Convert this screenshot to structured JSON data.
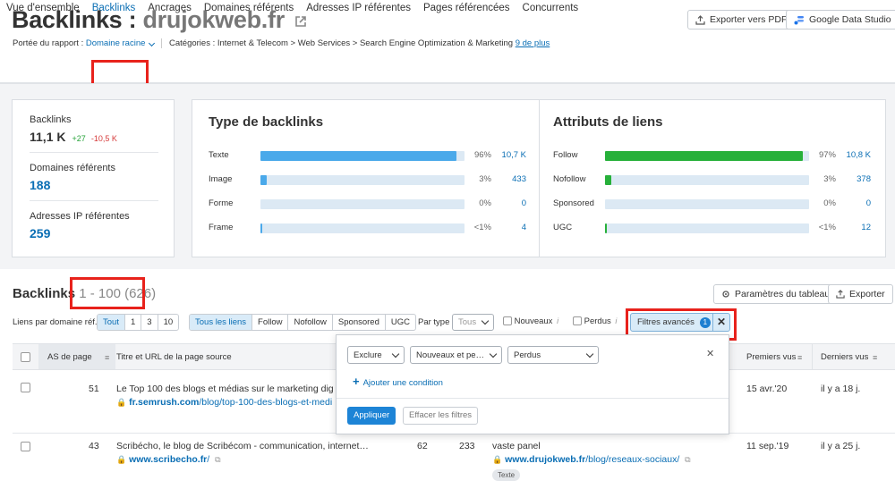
{
  "header": {
    "title_prefix": "Backlinks : ",
    "title_domain": "drujokweb.fr",
    "export_pdf": "Exporter vers PDF",
    "gds": "Google Data Studio"
  },
  "meta": {
    "scope_label": "Portée du rapport :",
    "scope_value": "Domaine racine",
    "categories": "Catégories : Internet & Telecom > Web Services > Search Engine Optimization & Marketing",
    "more": "9 de plus"
  },
  "tabs": [
    "Vue d'ensemble",
    "Backlinks",
    "Ancrages",
    "Domaines référents",
    "Adresses IP référentes",
    "Pages référencées",
    "Concurrents"
  ],
  "kpis": {
    "backlinks_label": "Backlinks",
    "backlinks_value": "11,1 K",
    "backlinks_up": "+27",
    "backlinks_down": "-10,5 K",
    "domains_label": "Domaines référents",
    "domains_value": "188",
    "ips_label": "Adresses IP référentes",
    "ips_value": "259"
  },
  "types": {
    "title": "Type de backlinks",
    "rows": [
      {
        "label": "Texte",
        "pct": "96%",
        "count": "10,7 K",
        "fill": 0.96
      },
      {
        "label": "Image",
        "pct": "3%",
        "count": "433",
        "fill": 0.03
      },
      {
        "label": "Forme",
        "pct": "0%",
        "count": "0",
        "fill": 0
      },
      {
        "label": "Frame",
        "pct": "<1%",
        "count": "4",
        "fill": 0.005
      }
    ]
  },
  "attributes": {
    "title": "Attributs de liens",
    "rows": [
      {
        "label": "Follow",
        "pct": "97%",
        "count": "10,8 K",
        "fill": 0.97
      },
      {
        "label": "Nofollow",
        "pct": "3%",
        "count": "378",
        "fill": 0.03
      },
      {
        "label": "Sponsored",
        "pct": "0%",
        "count": "0",
        "fill": 0
      },
      {
        "label": "UGC",
        "pct": "<1%",
        "count": "12",
        "fill": 0.005
      }
    ]
  },
  "colors": {
    "blue_bar": "#4aa9ea",
    "green_bar": "#27b03a",
    "bar_bg": "#dce9f4",
    "link": "#0a6eb4",
    "highlight": "#e8221c"
  },
  "section": {
    "title": "Backlinks",
    "count": " 1 - 100 (626)",
    "settings": "Paramètres du tableau",
    "export": "Exporter"
  },
  "filters": {
    "per_domain_label": "Liens par domaine réf.",
    "per_domain": [
      "Tout",
      "1",
      "3",
      "10"
    ],
    "link_types": [
      "Tous les liens",
      "Follow",
      "Nofollow",
      "Sponsored",
      "UGC"
    ],
    "par_type_label": "Par type",
    "par_type_value": "Tous",
    "nouveaux": "Nouveaux",
    "perdus": "Perdus",
    "advanced": "Filtres avancés",
    "advanced_count": "1"
  },
  "table": {
    "col_as": "AS de page",
    "col_title": "Titre et URL de la page source",
    "col_first": "Premiers vus",
    "col_last": "Derniers vus",
    "rows": [
      {
        "as": "51",
        "title": "Le Top 100 des blogs et médias sur le marketing dig",
        "domain": "fr.semrush.com",
        "path": "/blog/top-100-des-blogs-et-medi",
        "first": "15 avr.'20",
        "last": "il y a 18 j."
      },
      {
        "as": "43",
        "title": "Scribécho, le blog de Scribécom - communication, internet…",
        "domain": "www.scribecho.fr",
        "path": "/",
        "ext": "62",
        "int": "233",
        "anchor": "vaste panel",
        "target_domain": "www.drujokweb.fr",
        "target_path": "/blog/reseaux-sociaux/",
        "tag": "Texte",
        "first": "11 sep.'19",
        "last": "il y a 25 j."
      }
    ]
  },
  "popup": {
    "sel1": "Exclure",
    "sel2": "Nouveaux et pe…",
    "sel3": "Perdus",
    "add": "Ajouter une condition",
    "apply": "Appliquer",
    "clear": "Effacer les filtres"
  }
}
